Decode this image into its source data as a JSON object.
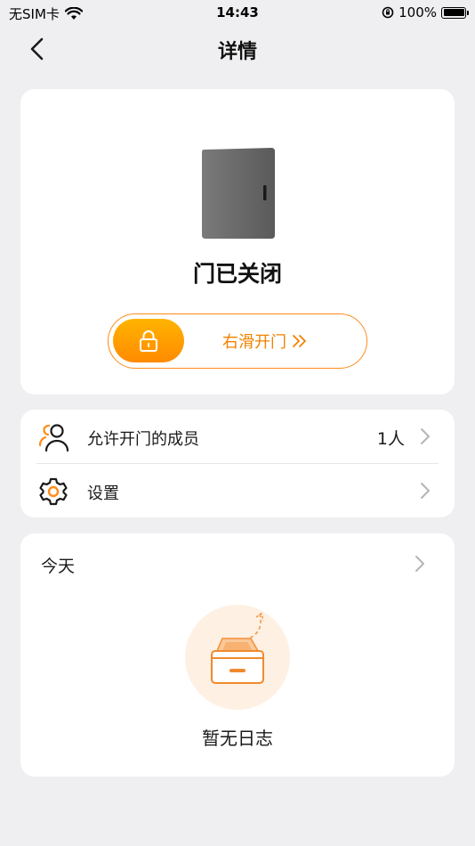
{
  "status_bar": {
    "carrier": "无SIM卡",
    "time": "14:43",
    "battery": "100%"
  },
  "nav": {
    "title": "详情"
  },
  "door": {
    "status": "门已关闭",
    "slider_label": "右滑开门"
  },
  "menu": {
    "members": {
      "label": "允许开门的成员",
      "value": "1人"
    },
    "settings": {
      "label": "设置"
    }
  },
  "log": {
    "title": "今天",
    "empty": "暂无日志"
  },
  "colors": {
    "accent": "#ff8c1a",
    "accent_light": "#ffb400",
    "background": "#efeff1"
  }
}
